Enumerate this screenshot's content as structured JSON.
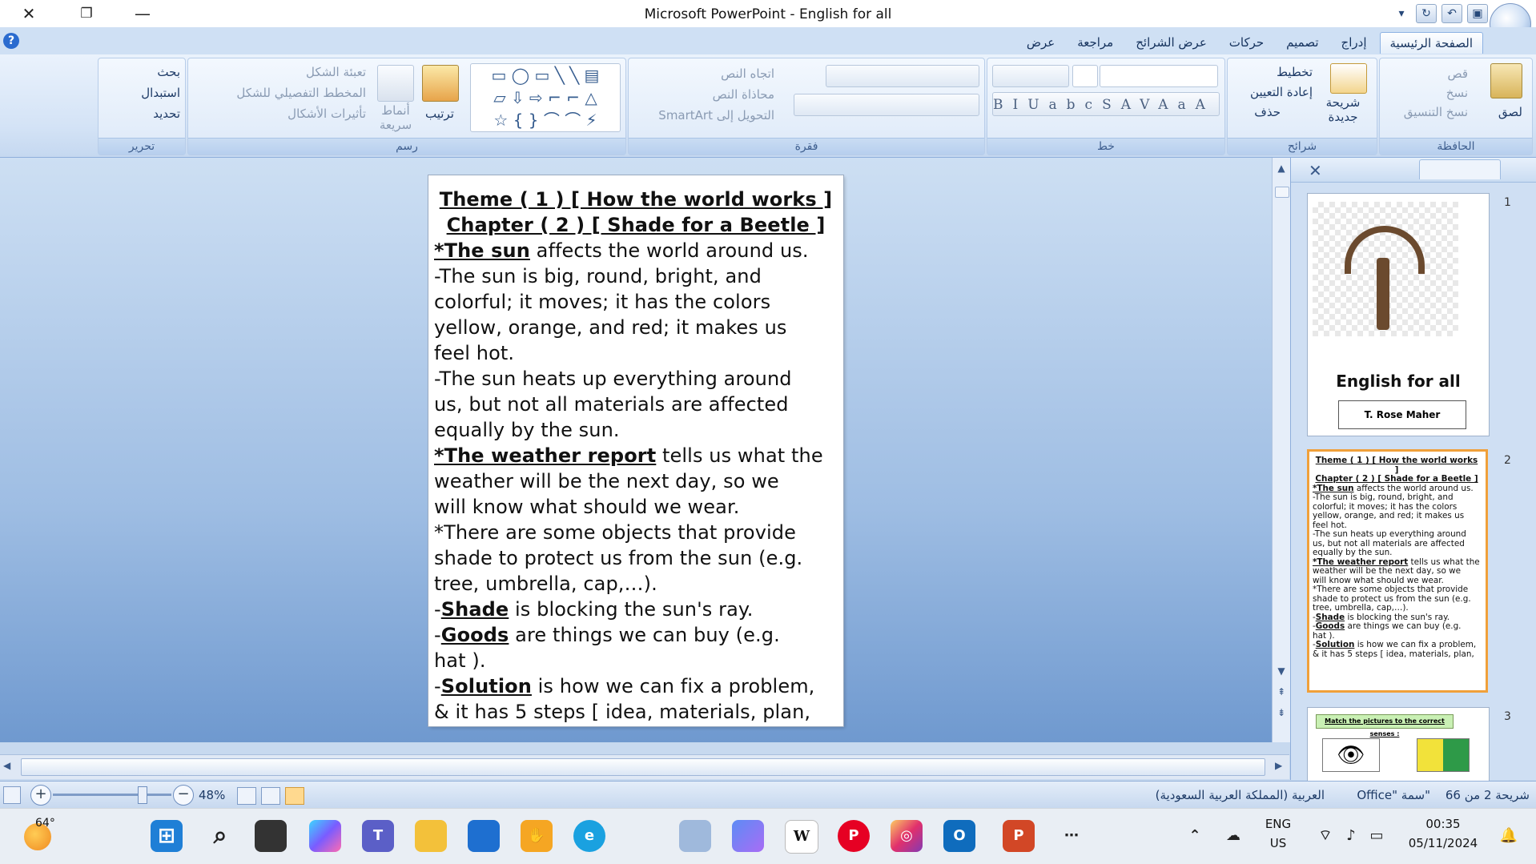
{
  "window": {
    "title": "Microsoft PowerPoint - English for all",
    "close_glyph": "✕",
    "restore_glyph": "❐",
    "minimize_glyph": "—"
  },
  "tabs": [
    "الصفحة الرئيسية",
    "إدراج",
    "تصميم",
    "حركات",
    "عرض الشرائح",
    "مراجعة",
    "عرض"
  ],
  "ribbon": {
    "clipboard": {
      "label": "الحافظة",
      "paste": "لصق",
      "cut": "قص",
      "copy": "نسخ",
      "format_painter": "نسخ التنسيق"
    },
    "slides": {
      "label": "شرائح",
      "new_slide": "شريحة جديدة",
      "layout": "تخطيط",
      "reset": "إعادة التعيين",
      "delete": "حذف"
    },
    "font": {
      "label": "خط"
    },
    "paragraph": {
      "label": "فقرة",
      "text_direction": "اتجاه النص",
      "align_text": "محاذاة النص",
      "smartart": "التحويل إلى SmartArt"
    },
    "drawing": {
      "label": "رسم",
      "arrange": "ترتيب",
      "quick_styles": "أنماط سريعة",
      "shape_fill": "تعبئة الشكل",
      "shape_outline": "المخطط التفصيلي للشكل",
      "shape_effects": "تأثيرات الأشكال"
    },
    "editing": {
      "label": "تحرير",
      "find": "بحث",
      "replace": "استبدال",
      "select": "تحديد"
    }
  },
  "slide": {
    "title1": "Theme ( 1 ) [ How the world works ]",
    "title2": "Chapter ( 2 ) [ Shade for a Beetle ]",
    "l1_b": "*The sun",
    "l1_t": " affects the world around us.",
    "l2": "-The sun is big, round, bright, and",
    "l3": "colorful; it moves; it has the colors",
    "l4": "yellow, orange, and red; it makes us",
    "l5": "feel hot.",
    "l6": "-The sun heats up everything around",
    "l7": "us, but not all materials are affected",
    "l8": "equally by the sun.",
    "l9_b": "*The weather report",
    "l9_t": " tells us what the",
    "l10": "weather will be the next day, so we",
    "l11": "will know what should we wear.",
    "l12": "*There are some objects that provide",
    "l13": "shade to protect us from the sun (e.g.",
    "l14": "tree, umbrella, cap,…).",
    "l15_p": "-",
    "l15_b": "Shade",
    "l15_t": " is blocking the sun's ray.",
    "l16_p": "-",
    "l16_b": "Goods",
    "l16_t": " are things we can buy (e.g.",
    "l17": "hat ).",
    "l18_p": "-",
    "l18_b": "Solution",
    "l18_t": " is how we can fix a problem,",
    "l19": "& it has 5 steps [ idea, materials, plan,"
  },
  "thumbnails": {
    "n1": "1",
    "n2": "2",
    "n3": "3",
    "t1_title": "English for all",
    "t1_author": "T. Rose Maher",
    "t3_title": "Match the pictures to the correct senses :"
  },
  "status": {
    "slide_of": "شريحة 2 من 66",
    "theme": "\"سمة \"Office",
    "language": "العربية (المملكة العربية السعودية)",
    "zoom": "48%"
  },
  "taskbar": {
    "weather_temp": "64°",
    "lang1": "ENG",
    "lang2": "US",
    "time": "00:35",
    "date": "05/11/2024"
  }
}
